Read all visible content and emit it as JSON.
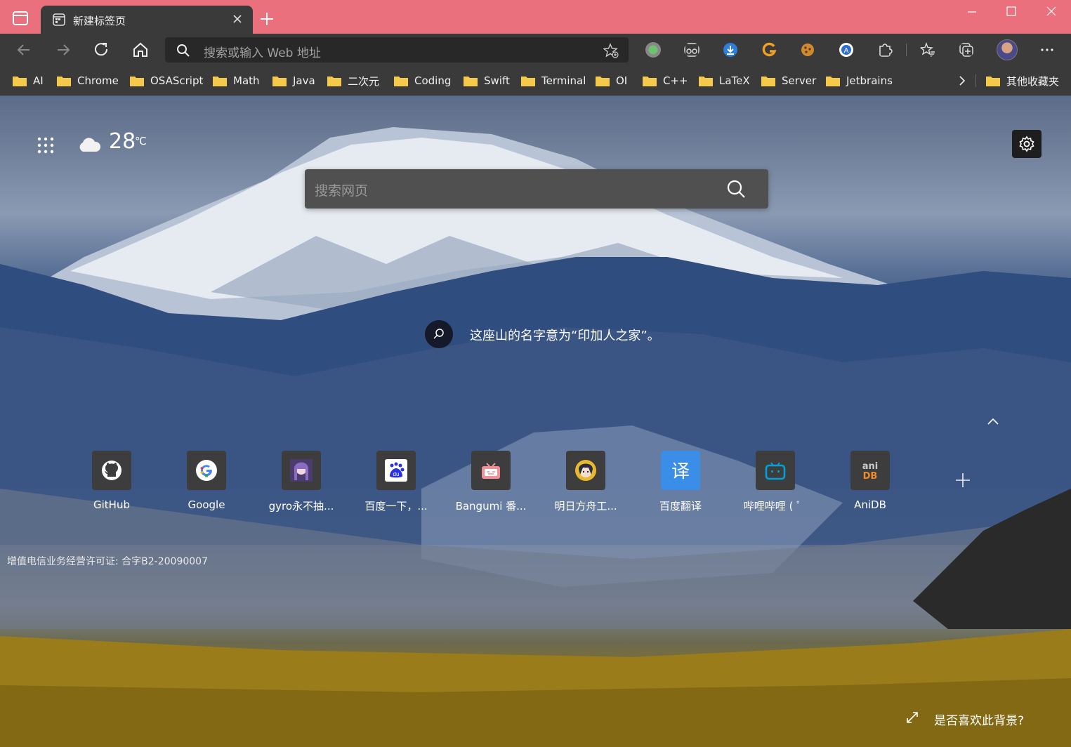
{
  "window": {
    "tab_title": "新建标签页",
    "controls": [
      "minimize-icon",
      "maximize-icon",
      "close-icon"
    ],
    "titlebar_color": "#e9707c"
  },
  "toolbar": {
    "address_placeholder": "搜索或输入 Web 地址",
    "buttons": [
      "back-icon",
      "forward-icon",
      "refresh-icon",
      "home-icon"
    ],
    "extensions": [
      "record-extension-icon",
      "glasses-extension-icon",
      "download-extension-icon",
      "grammarly-extension-icon",
      "cookie-extension-icon",
      "translate-extension-icon",
      "extensions-puzzle-icon",
      "favorites-icon",
      "collections-icon",
      "profile-avatar",
      "more-menu-icon"
    ]
  },
  "bookmarks": {
    "items": [
      "AI",
      "Chrome",
      "OSAScript",
      "Math",
      "Java",
      "二次元",
      "Coding",
      "Swift",
      "Terminal",
      "OI",
      "C++",
      "LaTeX",
      "Server",
      "Jetbrains"
    ],
    "other": "其他收藏夹"
  },
  "newtab": {
    "temperature": "28",
    "temperature_unit": "℃",
    "search_placeholder": "搜索网页",
    "caption": "这座山的名字意为“印加人之家”。",
    "license": "增值电信业务经营许可证: 合字B2-20090007",
    "like_background": "是否喜欢此背景?",
    "quick_links": [
      {
        "label": "GitHub",
        "icon": "github-icon"
      },
      {
        "label": "Google",
        "icon": "google-icon"
      },
      {
        "label": "gyro永不抽...",
        "icon": "anime-avatar-icon"
      },
      {
        "label": "百度一下，...",
        "icon": "baidu-icon"
      },
      {
        "label": "Bangumi 番...",
        "icon": "bangumi-icon"
      },
      {
        "label": "明日方舟工...",
        "icon": "arknights-icon"
      },
      {
        "label": "百度翻译",
        "icon": "baidu-translate-icon"
      },
      {
        "label": "哔哩哔哩 ( ゜",
        "icon": "bilibili-icon"
      },
      {
        "label": "AniDB",
        "icon": "anidb-icon"
      }
    ]
  }
}
